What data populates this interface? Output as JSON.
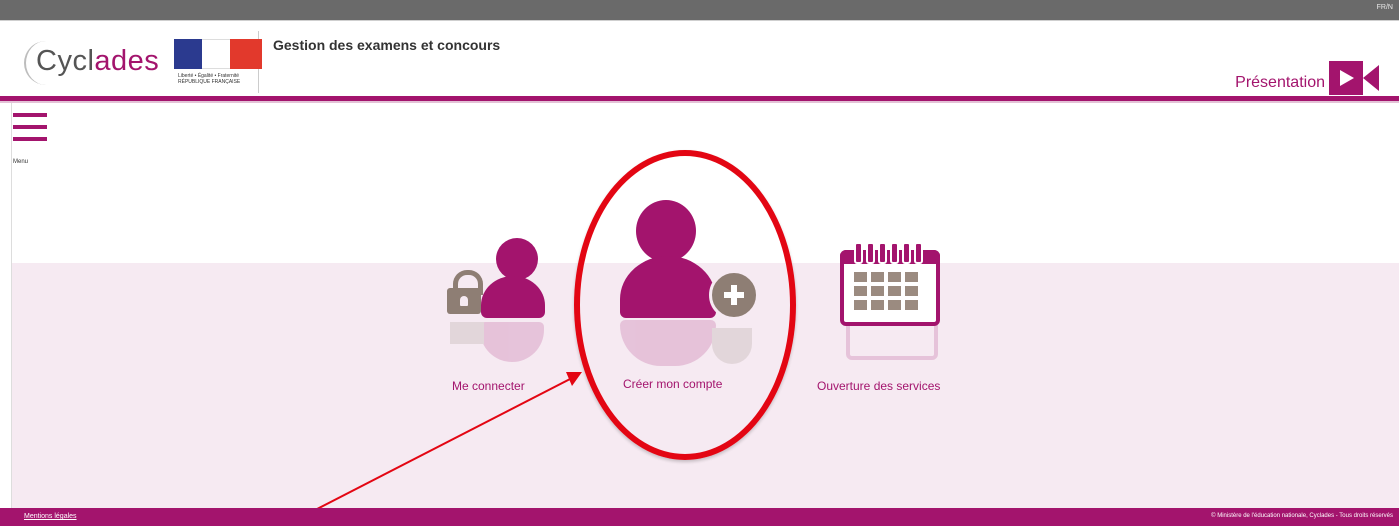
{
  "topbar": {
    "right_text": "FR/N"
  },
  "header": {
    "logo": {
      "text_main": "Cycl",
      "text_accent": "ades"
    },
    "flag_caption": "Liberté • Égalité • Fraternité RÉPUBLIQUE FRANÇAISE",
    "app_title": "Gestion des examens et concours",
    "presentation_label": "Présentation"
  },
  "menu": {
    "label": "Menu"
  },
  "tiles": [
    {
      "label": "Me connecter",
      "icon": "user-lock-icon"
    },
    {
      "label": "Créer mon compte",
      "icon": "user-add-icon"
    },
    {
      "label": "Ouverture des services",
      "icon": "calendar-icon"
    }
  ],
  "annotation": {
    "highlight_color": "#e30613",
    "target": "Créer mon compte"
  },
  "footer": {
    "legal_link": "Mentions légales",
    "copyright": "© Ministère de l'éducation nationale, Cyclades - Tous droits réservés"
  },
  "colors": {
    "brand": "#a3146d",
    "accent_gray": "#8e7e74",
    "light_band": "#f6eaf2"
  }
}
